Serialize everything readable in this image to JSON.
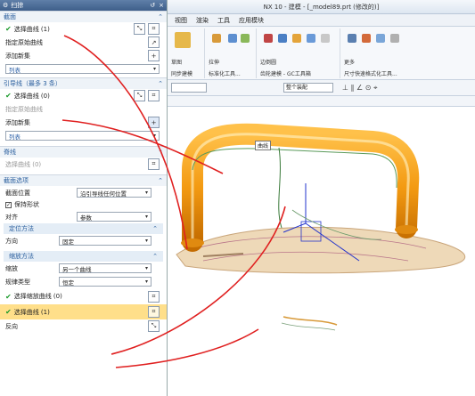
{
  "dialog": {
    "title": "扫掠",
    "sections": {
      "section": {
        "title": "截面",
        "select_curve": "选择曲线 (1)",
        "specify_origin": "指定原始曲线",
        "add_new_set": "添加新集",
        "list_label": "列表"
      },
      "guide": {
        "title": "引导线（最多 3 条）",
        "select_curve": "选择曲线 (0)",
        "specify_origin": "指定原始曲线",
        "add_new_set": "添加新集",
        "list_label": "列表"
      },
      "spine": {
        "title": "脊线",
        "select_curve": "选择曲线 (0)"
      },
      "section_options": {
        "title": "截面选项",
        "section_position_label": "截面位置",
        "section_position_value": "沿引导线任何位置",
        "preserve_shape": "保持形状",
        "align_label": "对齐",
        "align_value": "参数",
        "orientation": {
          "title": "定位方法",
          "direction_label": "方向",
          "direction_value": "固定"
        },
        "scaling": {
          "title": "缩放方法",
          "scale_label": "缩放",
          "scale_value": "另一个曲线",
          "law_type_label": "规律类型",
          "law_type_value": "恒定",
          "select_scale_curve": "选择缩放曲线 (0)",
          "select_curve": "选择曲线 (1)",
          "reverse": "反向"
        }
      }
    }
  },
  "nx": {
    "window_title": "NX 10 - 建模 - [_model89.prt  (修改的)]",
    "menu": [
      "视图",
      "渲染",
      "工具",
      "应用模块"
    ],
    "ribbon_groups": [
      "同步建模",
      "标准化工具...",
      "齿轮建模 - GC工具箱",
      "尺寸快速格式化工具..."
    ],
    "ribbon_labels": [
      "草图",
      "拉伸",
      "旋转",
      "基准平面",
      "边倒圆",
      "抽壳",
      "更多"
    ],
    "toolbar_filter": "整个装配",
    "curve_tag": "曲线"
  },
  "colors": {
    "section_header_text": "#2b5f9e",
    "highlight_row": "#ffdf8a",
    "check": "#1a9a2a",
    "handle_orange": "#f39a12",
    "base_tan": "#eed9b8",
    "annotation_red": "#e02020"
  }
}
